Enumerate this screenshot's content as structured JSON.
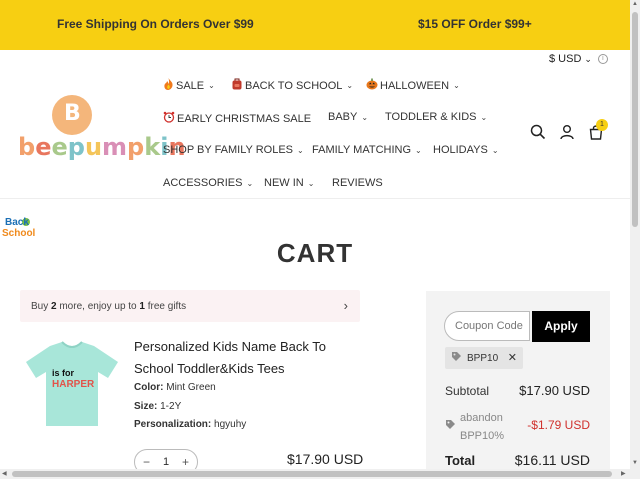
{
  "promo": {
    "left_text": "Free Shipping On Orders Over $99",
    "right_text": "$15 OFF Order $99+"
  },
  "header": {
    "currency": "$ USD",
    "cart_count": "1",
    "logo_badge_letter": "B",
    "logo_text": "beepumpkin",
    "nav": [
      {
        "label": "SALE",
        "icon": "fire-icon"
      },
      {
        "label": "BACK TO SCHOOL",
        "icon": "backpack-icon"
      },
      {
        "label": "HALLOWEEN",
        "icon": "pumpkin-icon"
      },
      {
        "label": "EARLY CHRISTMAS SALE",
        "icon": "alarm-clock-icon"
      },
      {
        "label": "BABY"
      },
      {
        "label": "TODDLER & KIDS"
      },
      {
        "label": "SHOP BY FAMILY ROLES"
      },
      {
        "label": "FAMILY MATCHING"
      },
      {
        "label": "HOLIDAYS"
      },
      {
        "label": "ACCESSORIES"
      },
      {
        "label": "NEW IN"
      },
      {
        "label": "REVIEWS"
      }
    ]
  },
  "badge": {
    "line1": "Back",
    "line2": "School"
  },
  "page_title": "CART",
  "gift_bar": {
    "pre": "Buy ",
    "count": "2",
    "mid": " more, enjoy up to ",
    "gifts": "1",
    "post": " free gifts"
  },
  "cart_item": {
    "title": "Personalized Kids Name Back To School Toddler&Kids Tees",
    "shirt_line1": "is for",
    "shirt_line2": "HARPER",
    "color_label": "Color:",
    "color_value": "Mint Green",
    "size_label": "Size:",
    "size_value": "1-2Y",
    "personalization_label": "Personalization:",
    "personalization_value": "hgyuhy",
    "quantity": "1",
    "price": "$17.90 USD"
  },
  "summary": {
    "coupon_placeholder": "Coupon Code",
    "apply_label": "Apply",
    "applied_code": "BPP10",
    "subtotal_label": "Subtotal",
    "subtotal_value": "$17.90 USD",
    "discount_line1": "abandon",
    "discount_line2": "BPP10%",
    "discount_value": "-$1.79 USD",
    "total_label": "Total",
    "total_value": "$16.11 USD"
  },
  "colors": {
    "promo_bg": "#f7cf12",
    "gift_bar_bg": "#fbf2f3",
    "summary_bg": "#f3f3f3",
    "discount_red": "#d0312d",
    "shirt_mint": "#a8e6d9"
  }
}
